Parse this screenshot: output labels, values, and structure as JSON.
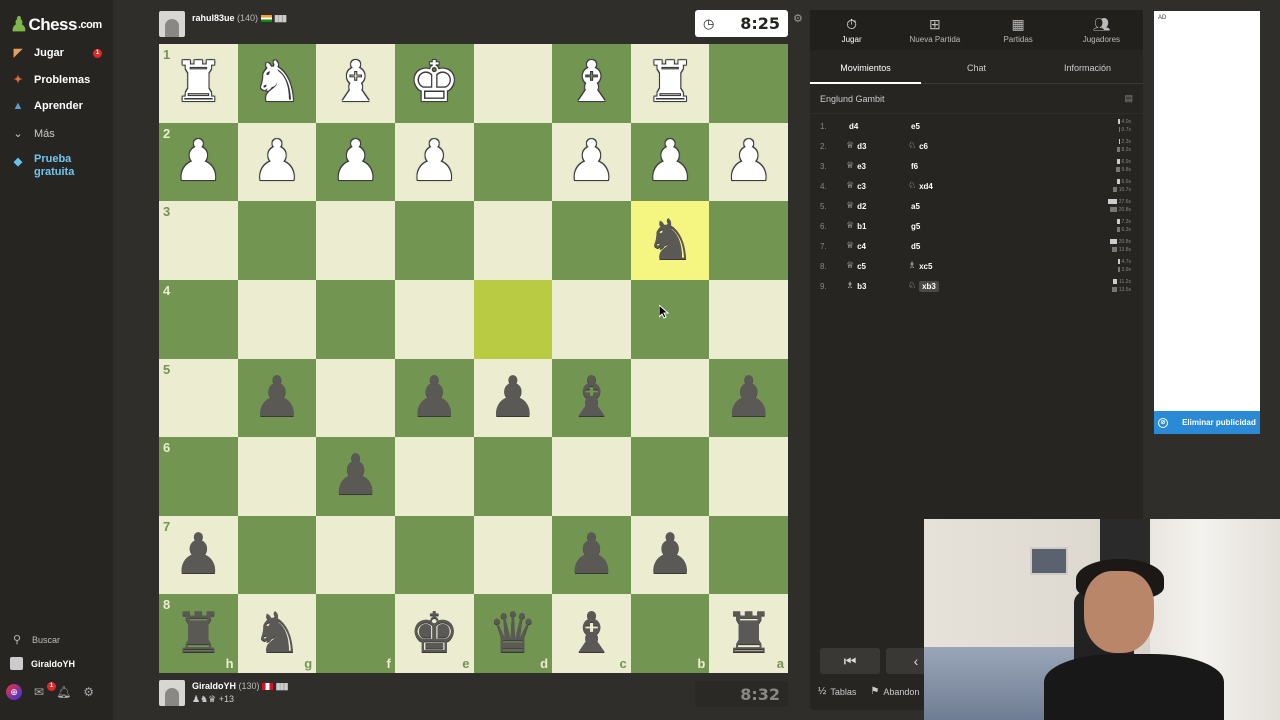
{
  "sidebar": {
    "logo_text": "Chess",
    "logo_tld": ".com",
    "items": [
      {
        "label": "Jugar",
        "icon": "play-icon",
        "badge": "1"
      },
      {
        "label": "Problemas",
        "icon": "puzzle-icon"
      },
      {
        "label": "Aprender",
        "icon": "learn-icon"
      },
      {
        "label": "Más",
        "icon": "chevron-down-icon"
      }
    ],
    "trial_label": "Prueba gratuita",
    "search_label": "Buscar",
    "user_label": "GiraldoYH",
    "messages_badge": "1"
  },
  "top_player": {
    "name": "rahul83ue",
    "rating": "(140)",
    "clock": "8:25"
  },
  "bottom_player": {
    "name": "GiraldoYH",
    "rating": "(130)",
    "captured_extra": "+13",
    "clock": "8:32"
  },
  "board": {
    "ranks": [
      "1",
      "2",
      "3",
      "4",
      "5",
      "6",
      "7",
      "8"
    ],
    "files": [
      "h",
      "g",
      "f",
      "e",
      "d",
      "c",
      "b",
      "a"
    ]
  },
  "panel": {
    "tabs": [
      {
        "label": "Jugar",
        "icon": "clock-icon"
      },
      {
        "label": "Nueva Partida",
        "icon": "plus-icon"
      },
      {
        "label": "Partidas",
        "icon": "board-icon"
      },
      {
        "label": "Jugadores",
        "icon": "players-icon"
      }
    ],
    "subtabs": [
      "Movimientos",
      "Chat",
      "Información"
    ],
    "opening": "Englund Gambit",
    "moves": [
      {
        "num": "1.",
        "white": "d4",
        "white_fig": "",
        "black": "e5",
        "black_fig": "",
        "wt": "4.0s",
        "bt": "0.7s"
      },
      {
        "num": "2.",
        "white": "d3",
        "white_fig": "♕",
        "black": "c6",
        "black_fig": "♘",
        "wt": "2.3s",
        "bt": "8.2s"
      },
      {
        "num": "3.",
        "white": "e3",
        "white_fig": "♕",
        "black": "f6",
        "black_fig": "",
        "wt": "6.9s",
        "bt": "9.8s"
      },
      {
        "num": "4.",
        "white": "c3",
        "white_fig": "♕",
        "black": "xd4",
        "black_fig": "♘",
        "wt": "6.6s",
        "bt": "10.7s"
      },
      {
        "num": "5.",
        "white": "d2",
        "white_fig": "♕",
        "black": "a5",
        "black_fig": "",
        "wt": "27.6s",
        "bt": "20.8s"
      },
      {
        "num": "6.",
        "white": "b1",
        "white_fig": "♕",
        "black": "g5",
        "black_fig": "",
        "wt": "7.3s",
        "bt": "6.3s"
      },
      {
        "num": "7.",
        "white": "c4",
        "white_fig": "♕",
        "black": "d5",
        "black_fig": "",
        "wt": "20.8s",
        "bt": "13.8s"
      },
      {
        "num": "8.",
        "white": "c5",
        "white_fig": "♕",
        "black": "xc5",
        "black_fig": "♗",
        "wt": "4.7s",
        "bt": "3.9s"
      },
      {
        "num": "9.",
        "white": "b3",
        "white_fig": "♗",
        "black": "xb3",
        "black_fig": "♘",
        "wt": "11.2s",
        "bt": "13.5s"
      }
    ],
    "draw_label": "Tablas",
    "resign_label": "Abandon"
  },
  "ad": {
    "label": "AD",
    "button_label": "Eliminar publicidad"
  }
}
